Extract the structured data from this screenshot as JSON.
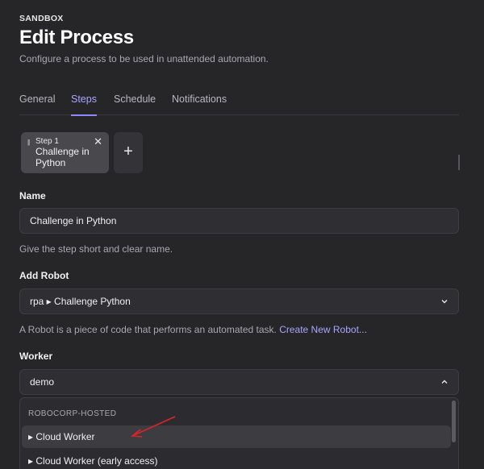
{
  "header": {
    "workspace": "SANDBOX",
    "title": "Edit Process",
    "subtitle": "Configure a process to be used in unattended automation."
  },
  "tabs": [
    {
      "label": "General"
    },
    {
      "label": "Steps",
      "active": true
    },
    {
      "label": "Schedule"
    },
    {
      "label": "Notifications"
    }
  ],
  "step": {
    "number": "Step 1",
    "name": "Challenge in Python",
    "handle_icon": "drag-handle-icon",
    "close_icon": "close-icon",
    "add_icon": "plus-icon"
  },
  "name_section": {
    "label": "Name",
    "value": "Challenge in Python",
    "help": "Give the step short and clear name."
  },
  "robot_section": {
    "label": "Add Robot",
    "value": "rpa ▸ Challenge Python",
    "help": "A Robot is a piece of code that performs an automated task.",
    "link": "Create New Robot..."
  },
  "worker_section": {
    "label": "Worker",
    "value": "demo",
    "dropdown": {
      "group": "ROBOCORP-HOSTED",
      "items": [
        {
          "label": "▸ Cloud Worker"
        },
        {
          "label": "▸ Cloud Worker (early access)"
        }
      ]
    }
  },
  "colors": {
    "background": "#262628",
    "accent": "#a9a4ff",
    "annotation_arrow": "#d9252a"
  }
}
